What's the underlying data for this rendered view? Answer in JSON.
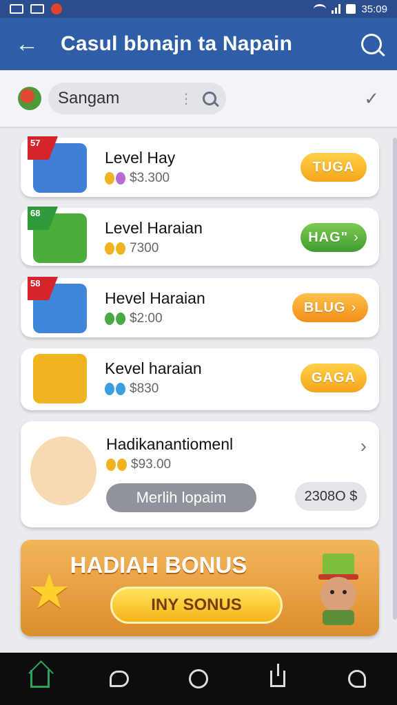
{
  "status_bar": {
    "time": "35:09"
  },
  "app_bar": {
    "title": "Casul bbnajn ta Napain"
  },
  "search": {
    "value": "Sangam"
  },
  "items": [
    {
      "ribbon": "57",
      "title": "Level Hay",
      "price": "$3.300",
      "button": "TUGA",
      "button_style": "orange",
      "chevron": "",
      "thumb_color": "#3f7fd6"
    },
    {
      "ribbon": "68",
      "title": "Level Haraian",
      "price": "7300",
      "button": "HAG\"",
      "button_style": "green",
      "chevron": "›",
      "thumb_color": "#4cae3a"
    },
    {
      "ribbon": "58",
      "title": "Hevel Haraian",
      "price": "$2:00",
      "button": "BLUG",
      "button_style": "orange2",
      "chevron": "›",
      "thumb_color": "#3f86d9"
    },
    {
      "ribbon": "",
      "title": "Kevel haraian",
      "price": "$830",
      "button": "GAGA",
      "button_style": "orange",
      "chevron": "",
      "thumb_color": "#f2b321"
    }
  ],
  "featured": {
    "title": "Hadikanantiomenl",
    "price": "$93.00",
    "action": "Merlih lopaim",
    "amount": "2308O $"
  },
  "bonus": {
    "title": "HADIAH BONUS",
    "button": "INY SONUS"
  },
  "colors": {
    "app_bar": "#2e5ea8",
    "accent_orange": "#f4a51a",
    "accent_green": "#3f9c2f",
    "nav_active": "#2ea35d"
  }
}
